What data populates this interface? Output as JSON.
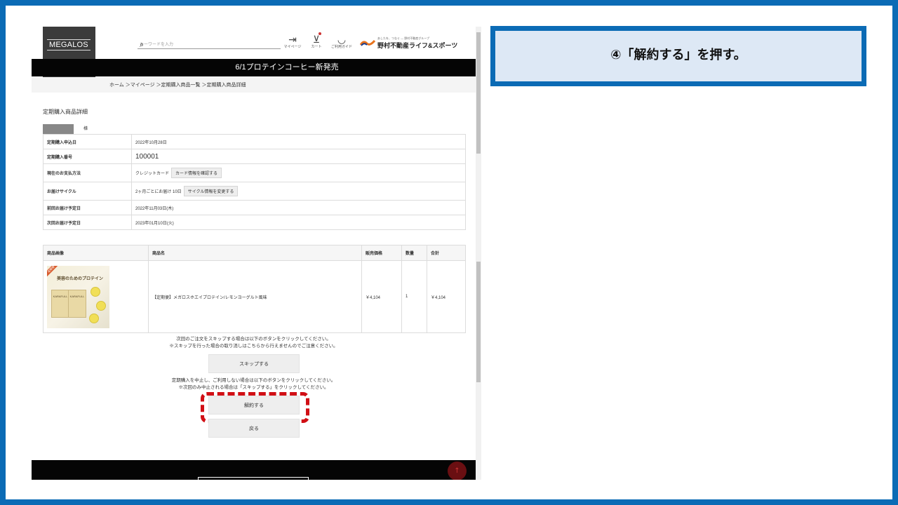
{
  "header": {
    "brand": "MEGALOS",
    "search_placeholder": "キーワードを入力",
    "mypage_label": "マイページ",
    "cart_label": "カート",
    "guide_label": "ご利用ガイド",
    "group_tagline": "あしたを、つなぐ ― 野村不動産グループ",
    "group_name": "野村不動産ライフ&スポーツ"
  },
  "banner": "6/1プロテインコーヒー新発売",
  "breadcrumb": "ホーム ＞マイページ ＞定期購入商品一覧 ＞定期購入商品詳細",
  "page_title": "定期購入商品詳細",
  "user_suffix": "様",
  "info": {
    "rows": [
      {
        "label": "定期購入申込日",
        "value": "2022年10月28日"
      },
      {
        "label": "定期購入番号",
        "value": "100001"
      },
      {
        "label": "現在のお支払方法",
        "value": "クレジットカード",
        "button": "カード情報を確認する"
      },
      {
        "label": "お届けサイクル",
        "value": "2ヶ月ごとにお届け 10日",
        "button": "サイクル情報を変更する"
      },
      {
        "label": "前回お届け予定日",
        "value": "2022年11月03日(木)"
      },
      {
        "label": "次回お届け予定日",
        "value": "2023年01月10日(火)"
      }
    ]
  },
  "items": {
    "headers": [
      "商品画像",
      "商品名",
      "販売価格",
      "数量",
      "合計"
    ],
    "row": {
      "image_tag": "定期便",
      "image_headline": "美容のためのプロテイン",
      "image_brand": "KARAFULL",
      "name": "【定期便】メガロスホエイプロテイン/レモンヨーグルト風味",
      "price": "￥4,104",
      "qty": "1",
      "total": "￥4,104"
    }
  },
  "skip_note": [
    "次回のご注文をスキップする場合は以下のボタンをクリックしてください。",
    "※スキップを行った場合の取り消しはこちらから行えませんのでご注意ください。"
  ],
  "skip_button": "スキップする",
  "cancel_note": [
    "定期購入を中止し、ご利用しない場合は以下のボタンをクリックしてください。",
    "※次回のみ中止される場合は「スキップする」をクリックしてください。"
  ],
  "cancel_button": "解約する",
  "back_button": "戻る",
  "top_button": "↑",
  "callout": "④「解約する」を押す。",
  "colors": {
    "frame": "#0b6bb5",
    "highlight": "#d10f15",
    "callout_bg": "#dde8f5"
  }
}
